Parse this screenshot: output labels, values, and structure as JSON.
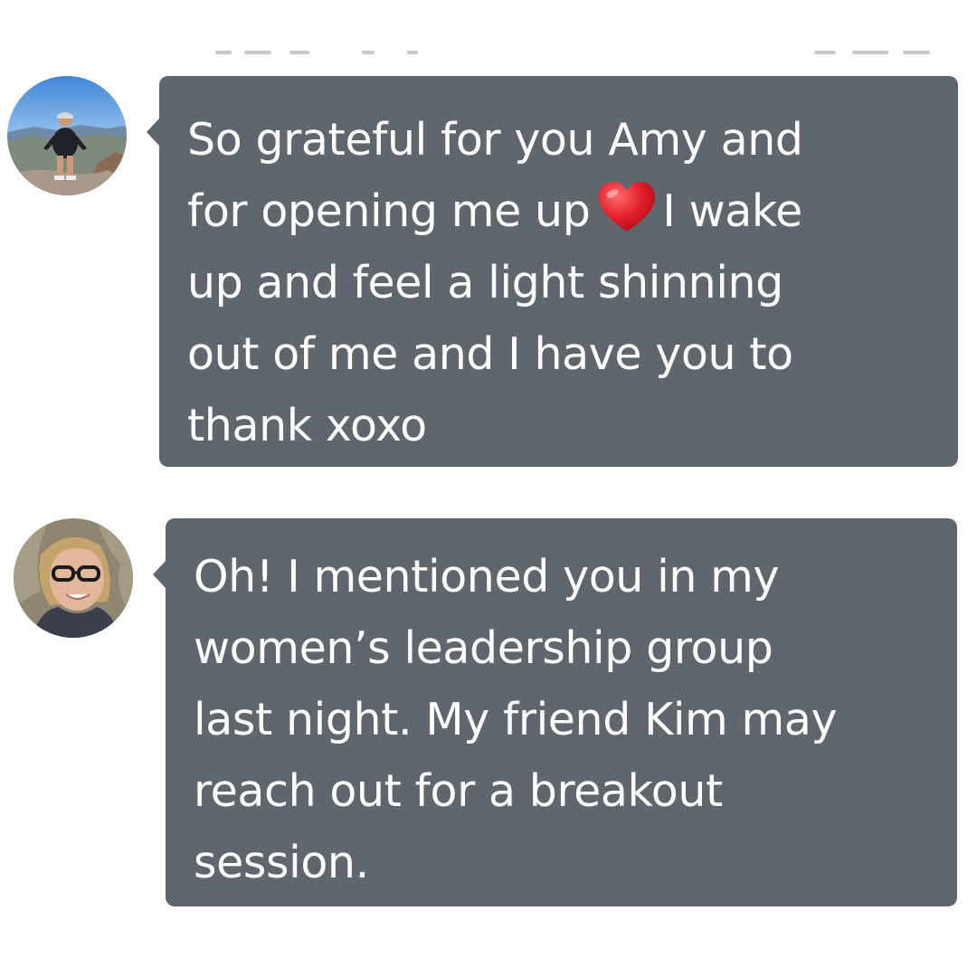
{
  "messages": [
    {
      "sender": "first-sender",
      "lines": [
        "So grateful for you Amy and",
        "for opening me up",
        "I wake",
        "up and feel a light shinning",
        "out of me and I have you to",
        "thank xoxo"
      ],
      "emoji": "heart-emoji"
    },
    {
      "sender": "second-sender",
      "lines": [
        "Oh! I mentioned you in my",
        "women’s leadership group",
        "last night. My friend Kim may",
        "reach out for a breakout",
        "session."
      ]
    }
  ],
  "colors": {
    "bubble": "#5f666d",
    "text": "#ffffff",
    "background": "#ffffff",
    "heart": "#e11d2a"
  }
}
